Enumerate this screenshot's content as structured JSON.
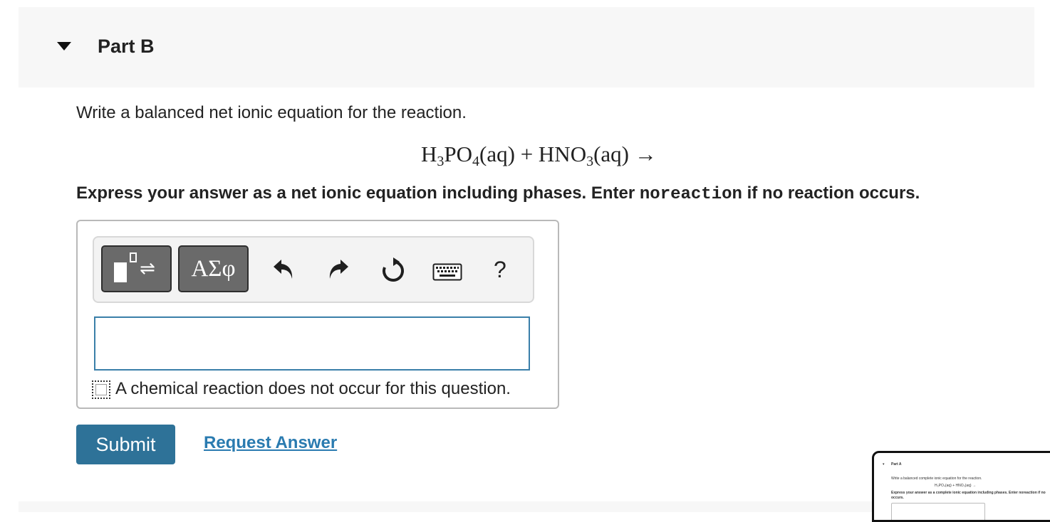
{
  "part": {
    "title": "Part B"
  },
  "question": {
    "prompt": "Write a balanced net ionic equation for the reaction.",
    "equation": {
      "reactant1_a": "H",
      "reactant1_sub1": "3",
      "reactant1_b": "PO",
      "reactant1_sub2": "4",
      "reactant1_phase": "(aq)",
      "plus": "+",
      "reactant2_a": "HNO",
      "reactant2_sub": "3",
      "reactant2_phase": "(aq)",
      "arrow": "→"
    },
    "instructions_before": "Express your answer as a net ionic equation including phases. Enter ",
    "instructions_code": "noreaction",
    "instructions_after": " if no reaction occurs."
  },
  "toolbar": {
    "greek_label": "ΑΣφ",
    "help_label": "?",
    "icons": [
      "template-icon",
      "greek-letters-icon",
      "undo-icon",
      "redo-icon",
      "reset-icon",
      "keyboard-icon",
      "help-icon"
    ]
  },
  "answer": {
    "value": "",
    "no_reaction_label": "A chemical reaction does not occur for this question.",
    "no_reaction_checked": false
  },
  "actions": {
    "submit_label": "Submit",
    "request_answer_label": "Request Answer"
  },
  "thumbnail": {
    "title": "Part A",
    "prompt": "Write a balanced complete ionic equation for the reaction.",
    "equation": "H₃PO₄(aq) + HNO₃(aq) →",
    "instructions": "Express your answer as a complete ionic equation including phases. Enter noreaction if no",
    "instructions_cont": "occurs."
  },
  "colors": {
    "header_bg": "#f7f7f7",
    "input_border": "#3a7fa9",
    "submit_bg": "#2e7298",
    "link": "#2a7bb0"
  }
}
